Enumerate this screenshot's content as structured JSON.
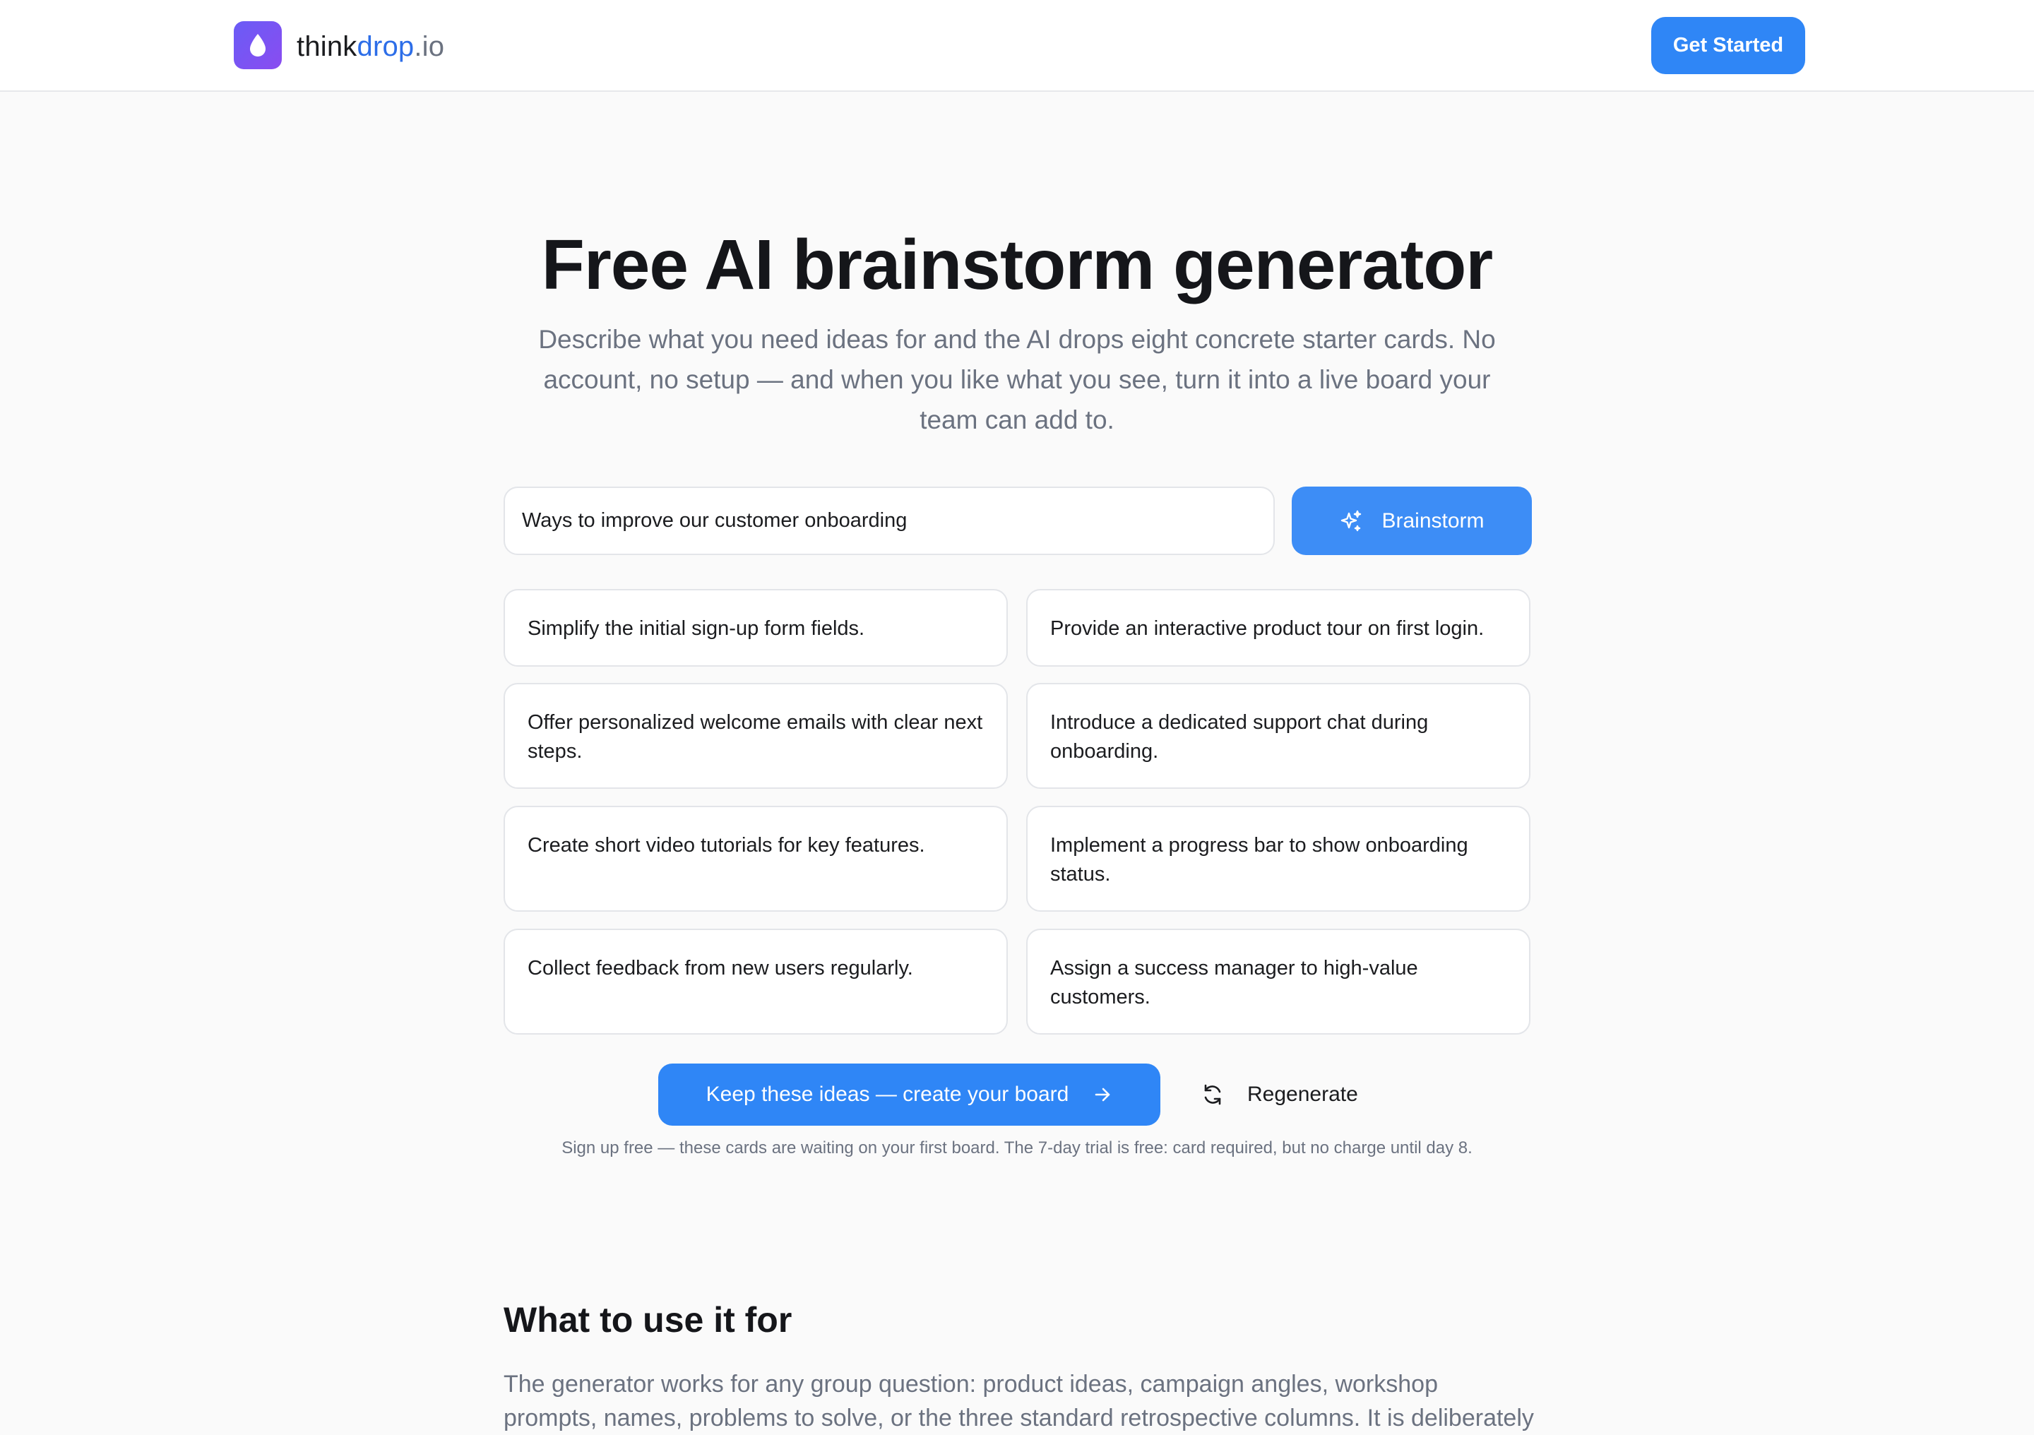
{
  "header": {
    "logo": {
      "think": "think",
      "drop": "drop",
      "io": ".io",
      "icon": "droplet-icon"
    },
    "cta_label": "Get Started"
  },
  "hero": {
    "title": "Free AI brainstorm generator",
    "subtitle": "Describe what you need ideas for and the AI drops eight concrete starter cards. No account, no setup — and when you like what you see, turn it into a live board your team can add to."
  },
  "prompt": {
    "value": "Ways to improve our customer onboarding",
    "button_label": "Brainstorm",
    "button_icon": "sparkles-icon"
  },
  "ideas": [
    "Simplify the initial sign-up form fields.",
    "Provide an interactive product tour on first login.",
    "Offer personalized welcome emails with clear next steps.",
    "Introduce a dedicated support chat during onboarding.",
    "Create short video tutorials for key features.",
    "Implement a progress bar to show onboarding status.",
    "Collect feedback from new users regularly.",
    "Assign a success manager to high-value customers."
  ],
  "actions": {
    "keep_label": "Keep these ideas — create your board",
    "keep_icon": "arrow-right-icon",
    "regenerate_label": "Regenerate",
    "regenerate_icon": "refresh-icon",
    "fine_print": "Sign up free — these cards are waiting on your first board. The 7-day trial is free: card required, but no charge until day 8."
  },
  "section": {
    "title": "What to use it for",
    "body": "The generator works for any group question: product ideas, campaign angles, workshop prompts, names, problems to solve, or the three standard retrospective columns. It is deliberately"
  },
  "colors": {
    "accent": "#2f86f6",
    "accent_light": "#3d8df6",
    "logo_gradient_start": "#6a5cf6",
    "logo_gradient_end": "#8a4cf0",
    "muted_text": "#6b7280",
    "border": "#e3e5e9"
  }
}
